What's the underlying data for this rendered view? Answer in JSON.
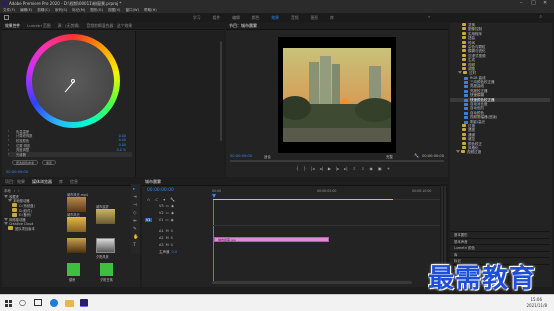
{
  "window": {
    "title": "Adobe Premiere Pro 2020 - D:\\视频\\00011\\粉窗景.prproj *",
    "menus": [
      "文件(F)",
      "编辑(E)",
      "剪辑(C)",
      "序列(S)",
      "标记(M)",
      "图形(G)",
      "视图(V)",
      "窗口(W)",
      "帮助(H)"
    ]
  },
  "workspace_tabs": [
    "学习",
    "组件",
    "编辑",
    "颜色",
    "效果",
    "音频",
    "图形",
    "库"
  ],
  "active_workspace": "效果",
  "effect_controls": {
    "tabs": [
      "Lumetri 范围",
      "源：(无剪辑)",
      "音频剪辑混合器：这个效果"
    ],
    "active_tab": "效果控件",
    "rows": [
      {
        "label": "色温温差",
        "value": ""
      },
      {
        "label": "计算修饰数",
        "value": "0.00"
      },
      {
        "label": "校准颜色",
        "value": "0.00"
      },
      {
        "label": "位置 阴影",
        "value": "0.00"
      },
      {
        "label": "亮度调整",
        "value": "0.0 %"
      },
      {
        "label": "光谱器",
        "value": ""
      }
    ],
    "buttons": [
      "更改颜色参考",
      "重置"
    ],
    "timecode": "00:00:00:00"
  },
  "program_monitor": {
    "tab": "节目：城市晨雾",
    "timecode_left": "00:00:00:00",
    "fit": "适合",
    "quality": "完整",
    "timecode_right": "00:00:00:00"
  },
  "project": {
    "tabs": [
      "项目：效果",
      "媒体浏览器",
      "库",
      "信息"
    ],
    "active_tab": "媒体浏览器",
    "path_label": "本地",
    "tree": [
      {
        "label": "收藏夹",
        "level": 0
      },
      {
        "label": "本地驱动器",
        "level": 1
      },
      {
        "label": "C:(系统盘)",
        "level": 2
      },
      {
        "label": "D:(软件)",
        "level": 2
      },
      {
        "label": "E:(备份)",
        "level": 2
      },
      {
        "label": "网络驱动器",
        "level": 0
      },
      {
        "label": "Creative Cloud",
        "level": 0
      },
      {
        "label": "团队项目版本",
        "level": 1
      }
    ],
    "thumbnails": [
      {
        "label": "城市风光.mp4"
      },
      {
        "label": "城市晨雾"
      },
      {
        "label": "城市风光"
      },
      {
        "label": "夕阳风景"
      },
      {
        "label": "楼房"
      },
      {
        "label": "夕阳日落"
      }
    ]
  },
  "timeline": {
    "tab": "城市晨雾",
    "timecode": "00:00:00:00",
    "ruler": [
      "00:00",
      "00:00:05:00",
      "00:00:10:00"
    ],
    "tracks": [
      "V3",
      "V2",
      "V1",
      "A1",
      "A2",
      "A3",
      "主声道"
    ],
    "master_value": "0.0",
    "clip_label": "城市晨雾.jpg"
  },
  "effects_panel": {
    "items": [
      {
        "label": "变换",
        "type": "folder"
      },
      {
        "label": "图像控制",
        "type": "folder"
      },
      {
        "label": "实用程序",
        "type": "folder"
      },
      {
        "label": "扭曲",
        "type": "folder"
      },
      {
        "label": "时间",
        "type": "folder"
      },
      {
        "label": "杂色与颗粒",
        "type": "folder"
      },
      {
        "label": "模糊与锐化",
        "type": "folder"
      },
      {
        "label": "沉浸式视频",
        "type": "folder"
      },
      {
        "label": "生成",
        "type": "folder"
      },
      {
        "label": "视频",
        "type": "folder"
      },
      {
        "label": "调整",
        "type": "folder"
      },
      {
        "label": "过时",
        "type": "folder-open"
      },
      {
        "label": "RGB 曲线",
        "type": "item"
      },
      {
        "label": "三向颜色校正器",
        "type": "item"
      },
      {
        "label": "亮度曲线",
        "type": "item"
      },
      {
        "label": "亮度校正器",
        "type": "item"
      },
      {
        "label": "快速模糊",
        "type": "item"
      },
      {
        "label": "快速颜色校正器",
        "type": "item",
        "selected": true
      },
      {
        "label": "自动对比度",
        "type": "item"
      },
      {
        "label": "自动色阶",
        "type": "item"
      },
      {
        "label": "自动颜色",
        "type": "item"
      },
      {
        "label": "视频限幅器(旧版)",
        "type": "item"
      },
      {
        "label": "阴影/高光",
        "type": "item"
      },
      {
        "label": "过渡",
        "type": "folder"
      },
      {
        "label": "透视",
        "type": "folder"
      },
      {
        "label": "通道",
        "type": "folder"
      },
      {
        "label": "键控",
        "type": "folder"
      },
      {
        "label": "颜色校正",
        "type": "folder"
      },
      {
        "label": "风格化",
        "type": "folder"
      },
      {
        "label": "视频过渡",
        "type": "folder"
      }
    ],
    "bottom": [
      "基本图形",
      "基本声音",
      "Lumetri 颜色",
      "库",
      "标记",
      "历史记录"
    ]
  },
  "watermark": "最需教育",
  "taskbar": {
    "time": "15:06",
    "date": "2021/11/8"
  },
  "colors": {
    "accent": "#2d8ceb",
    "clip": "#e08ad8",
    "bg": "#232323"
  }
}
